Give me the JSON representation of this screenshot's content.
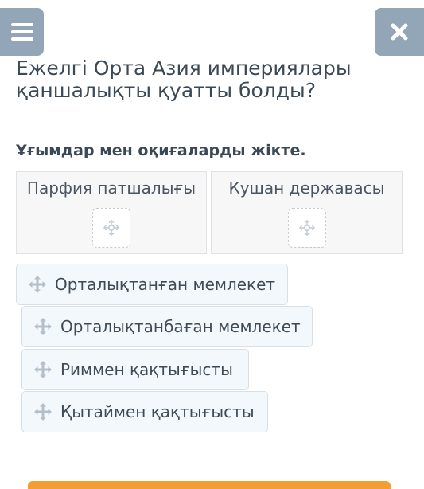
{
  "header": {
    "menu_icon": "hamburger-menu-icon",
    "close_icon": "close-icon",
    "button_color": "#93a6b8"
  },
  "question": {
    "title": "Ежелгі Орта Азия империялары қаншалықты қуатты болды?",
    "instruction": "Ұғымдар мен оқиғаларды жікте."
  },
  "categories": [
    {
      "label": "Парфия патшалығы",
      "drop_icon": "move-target-icon"
    },
    {
      "label": "Кушан державасы",
      "drop_icon": "move-target-icon"
    }
  ],
  "items": [
    {
      "label": "Орталықтанған мемлекет",
      "icon": "drag-handle-icon"
    },
    {
      "label": "Орталықтанбаған мемлекет",
      "icon": "drag-handle-icon"
    },
    {
      "label": "Риммен қақтығысты",
      "icon": "drag-handle-icon"
    },
    {
      "label": "Қытаймен қақтығысты",
      "icon": "drag-handle-icon"
    }
  ],
  "colors": {
    "accent": "#f39d33",
    "chip_background": "#f3f8fd",
    "text": "#3b4957"
  }
}
